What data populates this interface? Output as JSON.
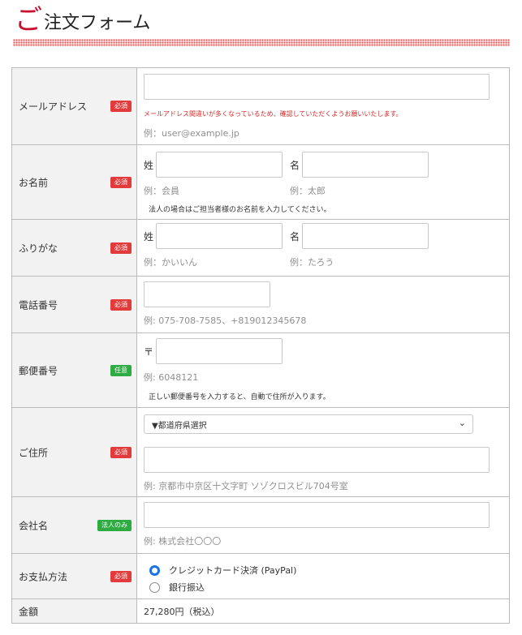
{
  "title": {
    "go": "ご",
    "rest": "注文フォーム"
  },
  "colors": {
    "accent": "#c8102e",
    "required_badge": "#e33b3b",
    "optional_badge": "#2eab41",
    "radio_selected": "#1a73e8"
  },
  "email": {
    "label": "メールアドレス",
    "badge": "必須",
    "warning": "メールアドレス間違いが多くなっているため、確認していただくようお願いいたします。",
    "hint": "例：user@example.jp"
  },
  "name": {
    "label": "お名前",
    "badge": "必須",
    "last_label": "姓",
    "first_label": "名",
    "last_hint": "例：会員",
    "first_hint": "例：太郎",
    "note": "法人の場合はご担当者様のお名前を入力してください。"
  },
  "furigana": {
    "label": "ふりがな",
    "badge": "必須",
    "last_label": "姓",
    "first_label": "名",
    "last_hint": "例：かいいん",
    "first_hint": "例：たろう"
  },
  "phone": {
    "label": "電話番号",
    "badge": "必須",
    "hint": "例: 075-708-7585、+819012345678"
  },
  "postal": {
    "label": "郵便番号",
    "badge": "任意",
    "prefix": "〒",
    "hint": "例: 6048121",
    "note": "正しい郵便番号を入力すると、自動で住所が入ります。"
  },
  "address": {
    "label": "ご住所",
    "badge": "必須",
    "prefecture_selected": "▼都道府県選択",
    "hint": "例: 京都市中京区十文字町 ソゾクロスビル704号室"
  },
  "company": {
    "label": "会社名",
    "badge": "法人のみ",
    "hint": "例: 株式会社〇〇〇"
  },
  "payment": {
    "label": "お支払方法",
    "badge": "必須",
    "options": [
      "クレジットカード決済 (PayPal)",
      "銀行振込"
    ]
  },
  "amount": {
    "label": "金額",
    "value": "27,280円（税込）"
  }
}
